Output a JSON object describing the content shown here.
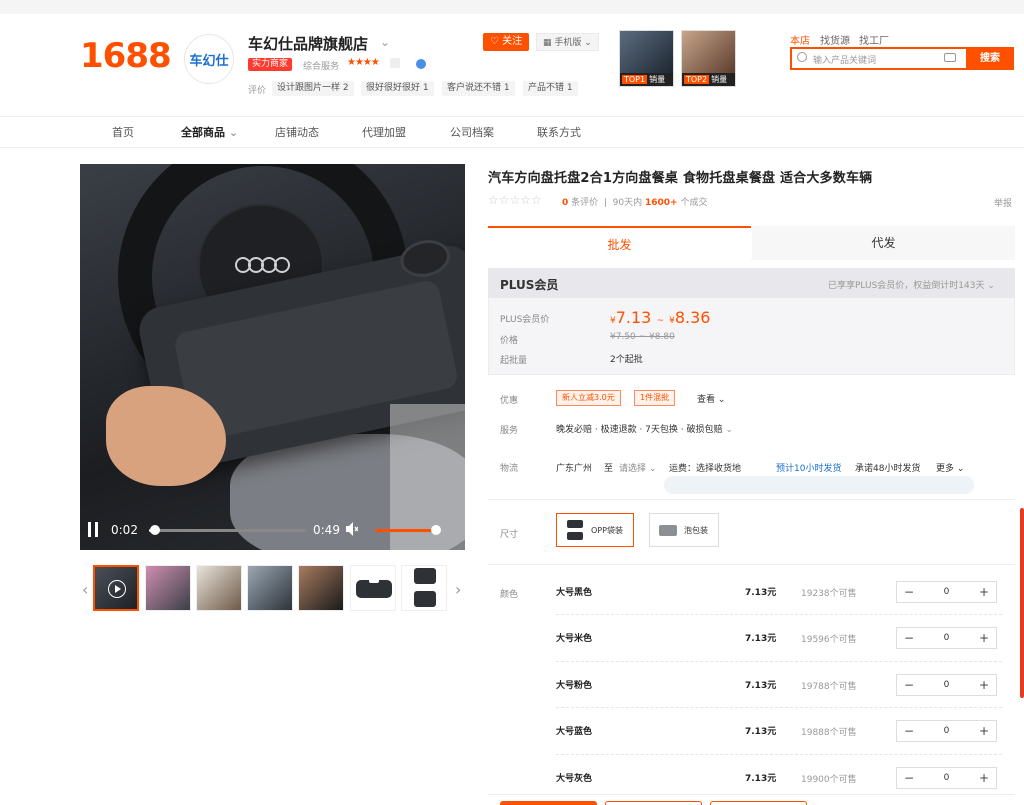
{
  "header": {
    "logo": "1688",
    "shop_avatar_text": "车幻仕",
    "shop_name": "车幻仕品牌旗舰店",
    "power_badge": "实力商家",
    "composite_label": "综合服务",
    "stars": "★★★★",
    "eval_label": "评价",
    "eval_tags": [
      "设计跟图片一样 2",
      "很好很好很好 1",
      "客户说还不错 1",
      "产品不错 1"
    ],
    "follow_label": "关注",
    "mobile_label": "手机版",
    "promo": [
      {
        "rank": "TOP1",
        "text": "销量"
      },
      {
        "rank": "TOP2",
        "text": "销量"
      }
    ],
    "scope_tabs": [
      "本店",
      "找货源",
      "找工厂"
    ],
    "search_placeholder": "输入产品关键词",
    "search_button": "搜索"
  },
  "nav": {
    "items": [
      "首页",
      "全部商品",
      "店铺动态",
      "代理加盟",
      "公司档案",
      "联系方式"
    ],
    "active_index": 1
  },
  "player": {
    "current_time": "0:02",
    "total_time": "0:49",
    "progress": 0.04,
    "volume": 0.9
  },
  "product": {
    "title": "汽车方向盘托盘2合1方向盘餐桌 食物托盘桌餐盘 适合大多数车辆",
    "review_count": "0",
    "review_suffix": "条评价",
    "sales_prefix": "90天内",
    "sales_count": "1600+",
    "sales_suffix": "个成交",
    "report": "举报",
    "tabs": [
      "批发",
      "代发"
    ]
  },
  "plus": {
    "title": "PLUS会员",
    "note": "已享享PLUS会员价，权益倒计时143天",
    "price_label": "PLUS会员价",
    "price_low": "7.13",
    "price_high": "8.36",
    "currency": "¥",
    "tilde": "~",
    "orig_label": "价格",
    "orig_price": "¥7.50 ~ ¥8.80",
    "moq_label": "起批量",
    "moq": "2个起批"
  },
  "offers": {
    "label": "优惠",
    "coupons": [
      "新人立减3.0元",
      "1件混批"
    ],
    "more": "查看"
  },
  "service": {
    "label": "服务",
    "text": "晚发必赔 · 极速退款 · 7天包换 · 破损包赔"
  },
  "logistics": {
    "label": "物流",
    "origin": "广东广州",
    "to": "至",
    "select": "请选择",
    "fee": "运费：选择收货地",
    "ship_time": "预计10小时发货",
    "promise": "承诺48小时发货",
    "more": "更多"
  },
  "size": {
    "label": "尺寸",
    "options": [
      "OPP袋装",
      "泡包装"
    ],
    "selected_index": 0
  },
  "colors": {
    "label": "颜色",
    "rows": [
      {
        "name": "大号黑色",
        "price": "7.13元",
        "stock": "19238个可售",
        "qty": "0"
      },
      {
        "name": "大号米色",
        "price": "7.13元",
        "stock": "19596个可售",
        "qty": "0"
      },
      {
        "name": "大号粉色",
        "price": "7.13元",
        "stock": "19788个可售",
        "qty": "0"
      },
      {
        "name": "大号蓝色",
        "price": "7.13元",
        "stock": "19888个可售",
        "qty": "0"
      },
      {
        "name": "大号灰色",
        "price": "7.13元",
        "stock": "19900个可售",
        "qty": "0"
      }
    ]
  },
  "colors_palette": {
    "brand": "#ff5000",
    "link": "#1a6fd1"
  },
  "icons": [
    "search-icon",
    "camera-icon",
    "chevron-down-icon",
    "heart-icon",
    "qr-icon",
    "play-icon",
    "pause-icon",
    "volume-icon",
    "chevron-left-icon",
    "chevron-right-icon",
    "minus-icon",
    "plus-icon"
  ]
}
